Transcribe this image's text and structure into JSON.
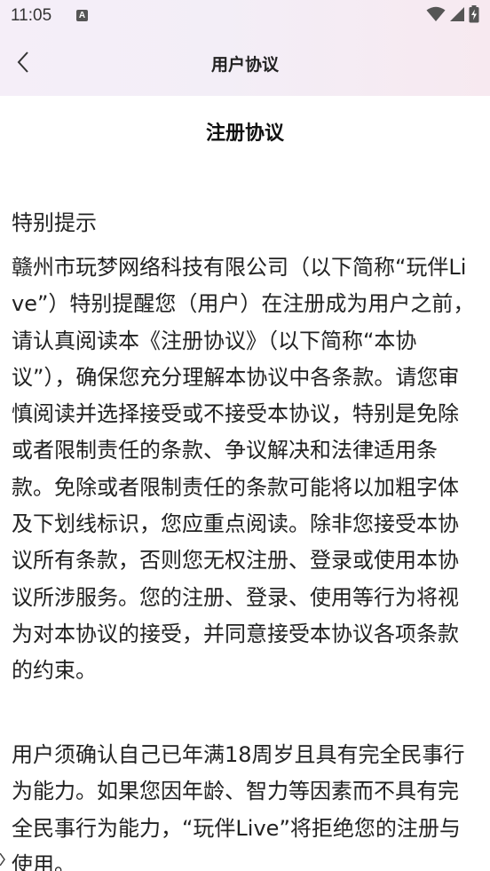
{
  "status_bar": {
    "time": "11:05",
    "notification_icon": "A",
    "icons": [
      "wifi-icon",
      "cellular-signal-icon",
      "battery-charging-icon"
    ]
  },
  "nav": {
    "back_icon": "chevron-left-icon",
    "title": "用户协议"
  },
  "document": {
    "title": "注册协议",
    "section_heading": "特别提示",
    "paragraphs": [
      "赣州市玩梦网络科技有限公司（以下简称“玩伴Live”）特别提醒您（用户）在注册成为用户之前，请认真阅读本《注册协议》（以下简称“本协议”），确保您充分理解本协议中各条款。请您审慎阅读并选择接受或不接受本协议，特别是免除或者限制责任的条款、争议解决和法律适用条款。免除或者限制责任的条款可能将以加粗字体及下划线标识，您应重点阅读。除非您接受本协议所有条款，否则您无权注册、登录或使用本协议所涉服务。您的注册、登录、使用等行为将视为对本协议的接受，并同意接受本协议各项条款的约束。",
      "用户须确认自己已年满18周岁且具有完全民事行为能力。如果您因年龄、智力等因素而不具有完全民事行为能力，“玩伴Live”将拒绝您的注册与使用。"
    ]
  },
  "colors": {
    "header_gradient_start": "#f5eef8",
    "header_gradient_end": "#f7e9f0",
    "text": "#222222",
    "background": "#ffffff"
  }
}
